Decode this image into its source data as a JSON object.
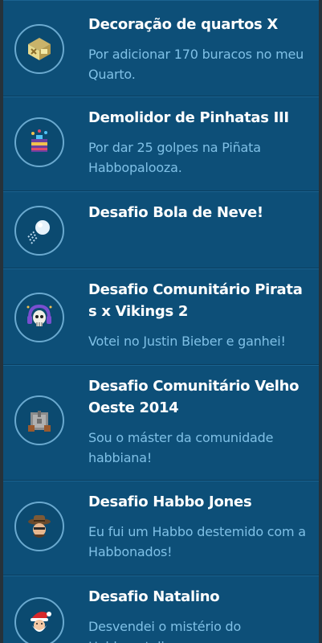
{
  "badges": [
    {
      "title": "Decoração de quartos X",
      "description": "Por adicionar 170 buracos no meu Quarto.",
      "icon": "room-decoration-badge-icon"
    },
    {
      "title": "Demolidor de Pinhatas III",
      "description": "Por dar 25 golpes na Piñata Habbopalooza.",
      "icon": "pinata-badge-icon"
    },
    {
      "title": "Desafio Bola de Neve!",
      "description": "",
      "icon": "snowball-badge-icon"
    },
    {
      "title": "Desafio Comunitário Piratas x Vikings 2",
      "description": "Votei no Justin Bieber e ganhei!",
      "icon": "skull-headphones-badge-icon"
    },
    {
      "title": "Desafio Comunitário Velho Oeste 2014",
      "description": "Sou o máster da comunidade habbiana!",
      "icon": "wild-west-badge-icon"
    },
    {
      "title": "Desafio Habbo Jones",
      "description": "Eu fui um Habbo destemido com a Habbonados!",
      "icon": "explorer-hat-badge-icon"
    },
    {
      "title": "Desafio Natalino",
      "description": "Desvendei o mistério do Habbonatalino",
      "icon": "santa-badge-icon"
    }
  ]
}
